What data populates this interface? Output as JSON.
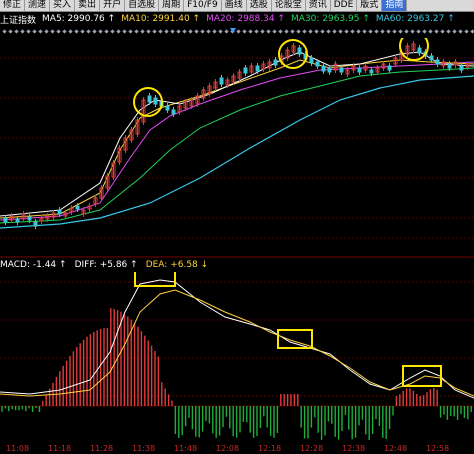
{
  "toolbar": {
    "items": [
      "修正",
      "测速",
      "买入",
      "卖出",
      "开户",
      "自选股",
      "周期",
      "F10/F9",
      "画线",
      "选股",
      "论股堂",
      "资讯",
      "DDE",
      "版式",
      "指南"
    ],
    "active_index": 14
  },
  "indicator": {
    "title": "上证指数",
    "ma": [
      {
        "label": "MA5: 2990.76 ↑",
        "color": "#ffffff"
      },
      {
        "label": "MA10: 2991.40 ↑",
        "color": "#ffd23f"
      },
      {
        "label": "MA20: 2988.34 ↑",
        "color": "#e34cf5"
      },
      {
        "label": "MA30: 2963.95 ↑",
        "color": "#22d35b"
      },
      {
        "label": "MA60: 2963.27 ↑",
        "color": "#38c8e8"
      }
    ]
  },
  "macd": {
    "labels": [
      {
        "text": "MACD: -1.44 ↑",
        "color": "#ffffff"
      },
      {
        "text": "DIFF: +5.86 ↑",
        "color": "#ffffff"
      },
      {
        "text": "DEA: +6.58 ↓",
        "color": "#ffd23f"
      }
    ]
  },
  "time_axis": {
    "labels": [
      "11:08",
      "11:18",
      "11:28",
      "11:38",
      "11:48",
      "12:08",
      "12:18",
      "12:28",
      "12:38",
      "12:48",
      "12:58"
    ]
  },
  "colors": {
    "up": "#e23b3b",
    "down": "#1fae3b",
    "highlight": "#ffe600",
    "grid": "#5a0000"
  }
}
